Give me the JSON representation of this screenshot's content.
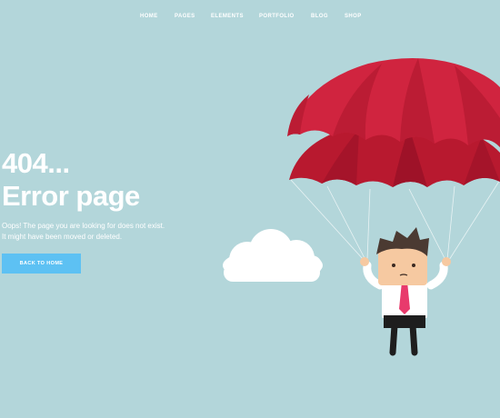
{
  "nav": {
    "items": [
      {
        "label": "HOME"
      },
      {
        "label": "PAGES"
      },
      {
        "label": "ELEMENTS"
      },
      {
        "label": "PORTFOLIO"
      },
      {
        "label": "BLOG"
      },
      {
        "label": "SHOP"
      }
    ]
  },
  "hero": {
    "code": "404...",
    "title": "Error page",
    "message_line1": "Oops! The page you are looking for does not exist.",
    "message_line2": "It might have been moved or deleted.",
    "button_label": "BACK TO HOME"
  },
  "colors": {
    "background": "#b3d6da",
    "accent": "#5dc1f3",
    "parachute": "#c8203b",
    "tie": "#e83a6c"
  },
  "icons": {
    "illustration": "parachuting-man-illustration",
    "cloud": "cloud-icon"
  }
}
